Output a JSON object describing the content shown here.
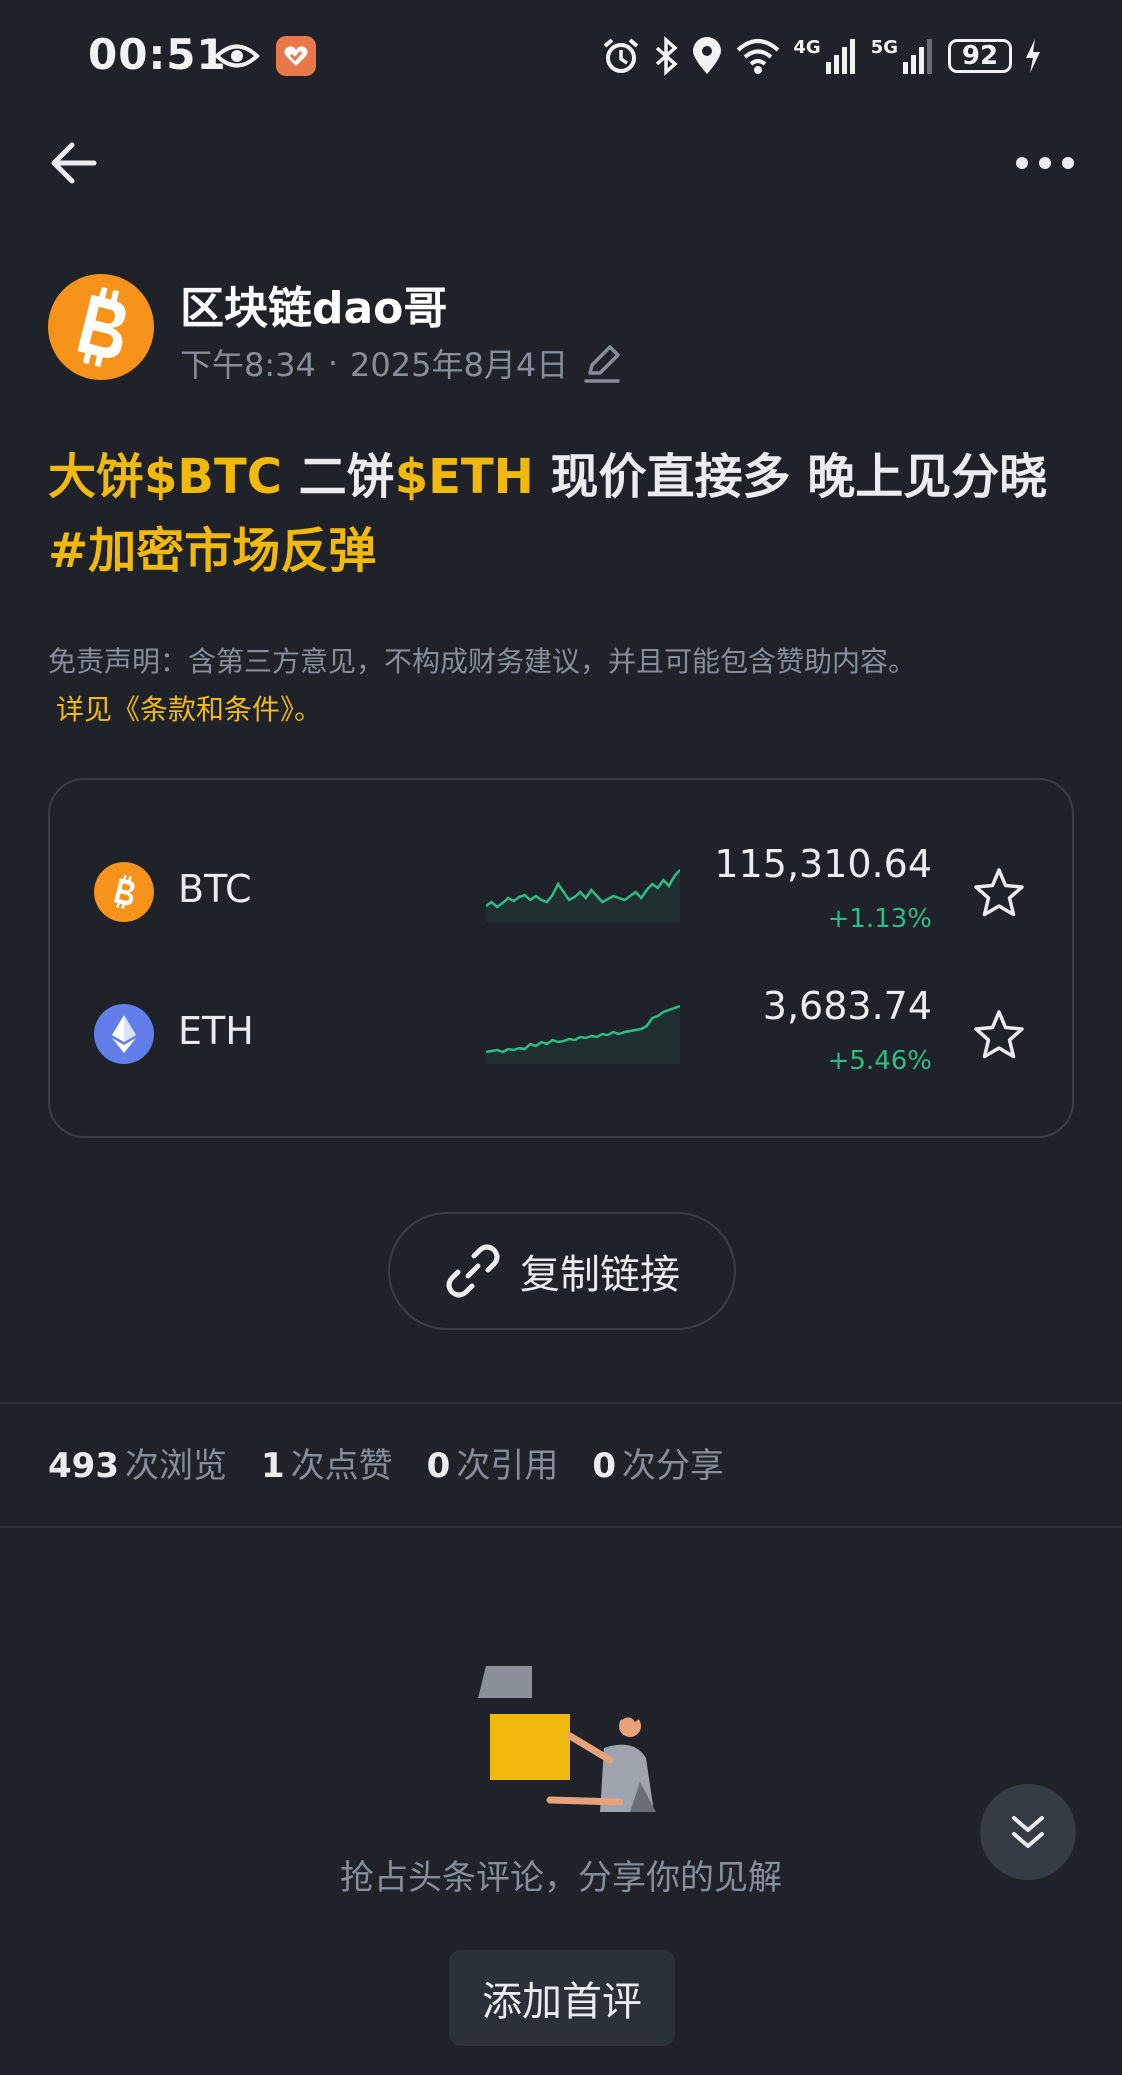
{
  "status_bar": {
    "time": "00:51",
    "net_4g": "4G",
    "net_5g": "5G",
    "battery": "92"
  },
  "author": {
    "name": "区块链dao哥",
    "time": "下午8:34",
    "separator": "·",
    "date": "2025年8月4日"
  },
  "post": {
    "segments": [
      {
        "text": "大饼$BTC",
        "highlight": true
      },
      {
        "text": " 二饼",
        "highlight": false
      },
      {
        "text": "$ETH",
        "highlight": true
      },
      {
        "text": " 现价直接多 晚上见分晓 ",
        "highlight": false
      },
      {
        "text": "#加密市场反弹",
        "highlight": true
      }
    ]
  },
  "disclaimer": {
    "text": "免责声明：含第三方意见，不构成财务建议，并且可能包含赞助内容。",
    "link": "详见《条款和条件》",
    "suffix": "。"
  },
  "market": {
    "coins": [
      {
        "symbol": "BTC",
        "price": "115,310.64",
        "change": "+1.13%",
        "icon": "bitcoin-icon",
        "color": "#f7931a",
        "sparkline": [
          44,
          40,
          45,
          41,
          36,
          39,
          35,
          33,
          38,
          34,
          38,
          40,
          33,
          22,
          30,
          38,
          35,
          30,
          36,
          28,
          34,
          40,
          37,
          34,
          36,
          38,
          34,
          30,
          36,
          28,
          22,
          26,
          18,
          24,
          14,
          8
        ]
      },
      {
        "symbol": "ETH",
        "price": "3,683.74",
        "change": "+5.46%",
        "icon": "ethereum-icon",
        "color": "#627eea",
        "sparkline": [
          48,
          47,
          46,
          48,
          45,
          46,
          44,
          45,
          40,
          42,
          38,
          40,
          36,
          38,
          37,
          35,
          36,
          33,
          34,
          32,
          33,
          30,
          31,
          28,
          30,
          28,
          27,
          26,
          25,
          22,
          14,
          12,
          8,
          6,
          4,
          2
        ]
      }
    ],
    "up_color": "#2ebd85"
  },
  "copy_link": {
    "label": "复制链接"
  },
  "stats": [
    {
      "num": "493",
      "label": "次浏览"
    },
    {
      "num": "1",
      "label": "次点赞"
    },
    {
      "num": "0",
      "label": "次引用"
    },
    {
      "num": "0",
      "label": "次分享"
    }
  ],
  "comments": {
    "empty_text": "抢占头条评论，分享你的见解",
    "add_button": "添加首评"
  },
  "theme": {
    "background": "#1f2329",
    "accent": "#f0b90b"
  }
}
